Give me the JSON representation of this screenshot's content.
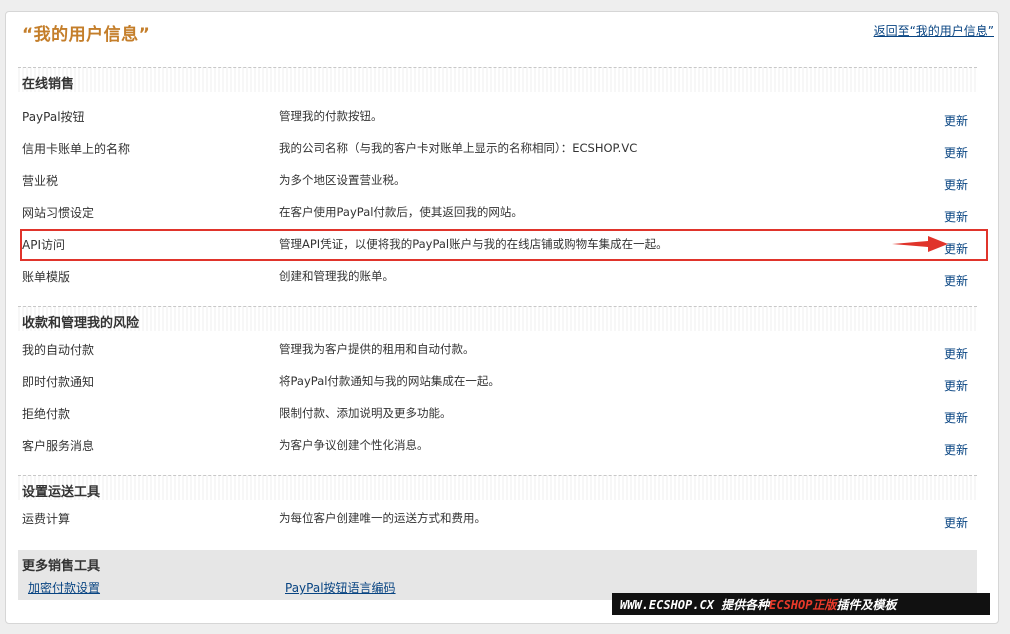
{
  "header": {
    "title": "“我的用户信息”",
    "back_link": "返回至“我的用户信息”"
  },
  "update_label": "更新",
  "sections": [
    {
      "title": "在线销售",
      "rows": [
        {
          "label": "PayPal按钮",
          "desc": "管理我的付款按钮。"
        },
        {
          "label": "信用卡账单上的名称",
          "desc": "我的公司名称（与我的客户卡对账单上显示的名称相同）：ECSHOP.VC"
        },
        {
          "label": "营业税",
          "desc": "为多个地区设置营业税。"
        },
        {
          "label": "网站习惯设定",
          "desc": "在客户使用PayPal付款后，使其返回我的网站。"
        },
        {
          "label": "API访问",
          "desc": "管理API凭证，以便将我的PayPal账户与我的在线店铺或购物车集成在一起。"
        },
        {
          "label": "账单模版",
          "desc": "创建和管理我的账单。"
        }
      ]
    },
    {
      "title": "收款和管理我的风险",
      "rows": [
        {
          "label": "我的自动付款",
          "desc": "管理我为客户提供的租用和自动付款。"
        },
        {
          "label": "即时付款通知",
          "desc": "将PayPal付款通知与我的网站集成在一起。"
        },
        {
          "label": "拒绝付款",
          "desc": "限制付款、添加说明及更多功能。"
        },
        {
          "label": "客户服务消息",
          "desc": "为客户争议创建个性化消息。"
        }
      ]
    },
    {
      "title": "设置运送工具",
      "rows": [
        {
          "label": "运费计算",
          "desc": "为每位客户创建唯一的运送方式和费用。"
        }
      ]
    }
  ],
  "more_tools": {
    "title": "更多销售工具",
    "links": [
      "加密付款设置",
      "PayPal按钮语言编码"
    ]
  },
  "banner": {
    "site": "WWW.ECSHOP.CX",
    "text1": " 提供各种",
    "highlight": "ECSHOP正版",
    "text2": "插件及模板"
  },
  "colors": {
    "title": "#c47e2a",
    "link": "#084482",
    "highlight": "#e0342b"
  }
}
